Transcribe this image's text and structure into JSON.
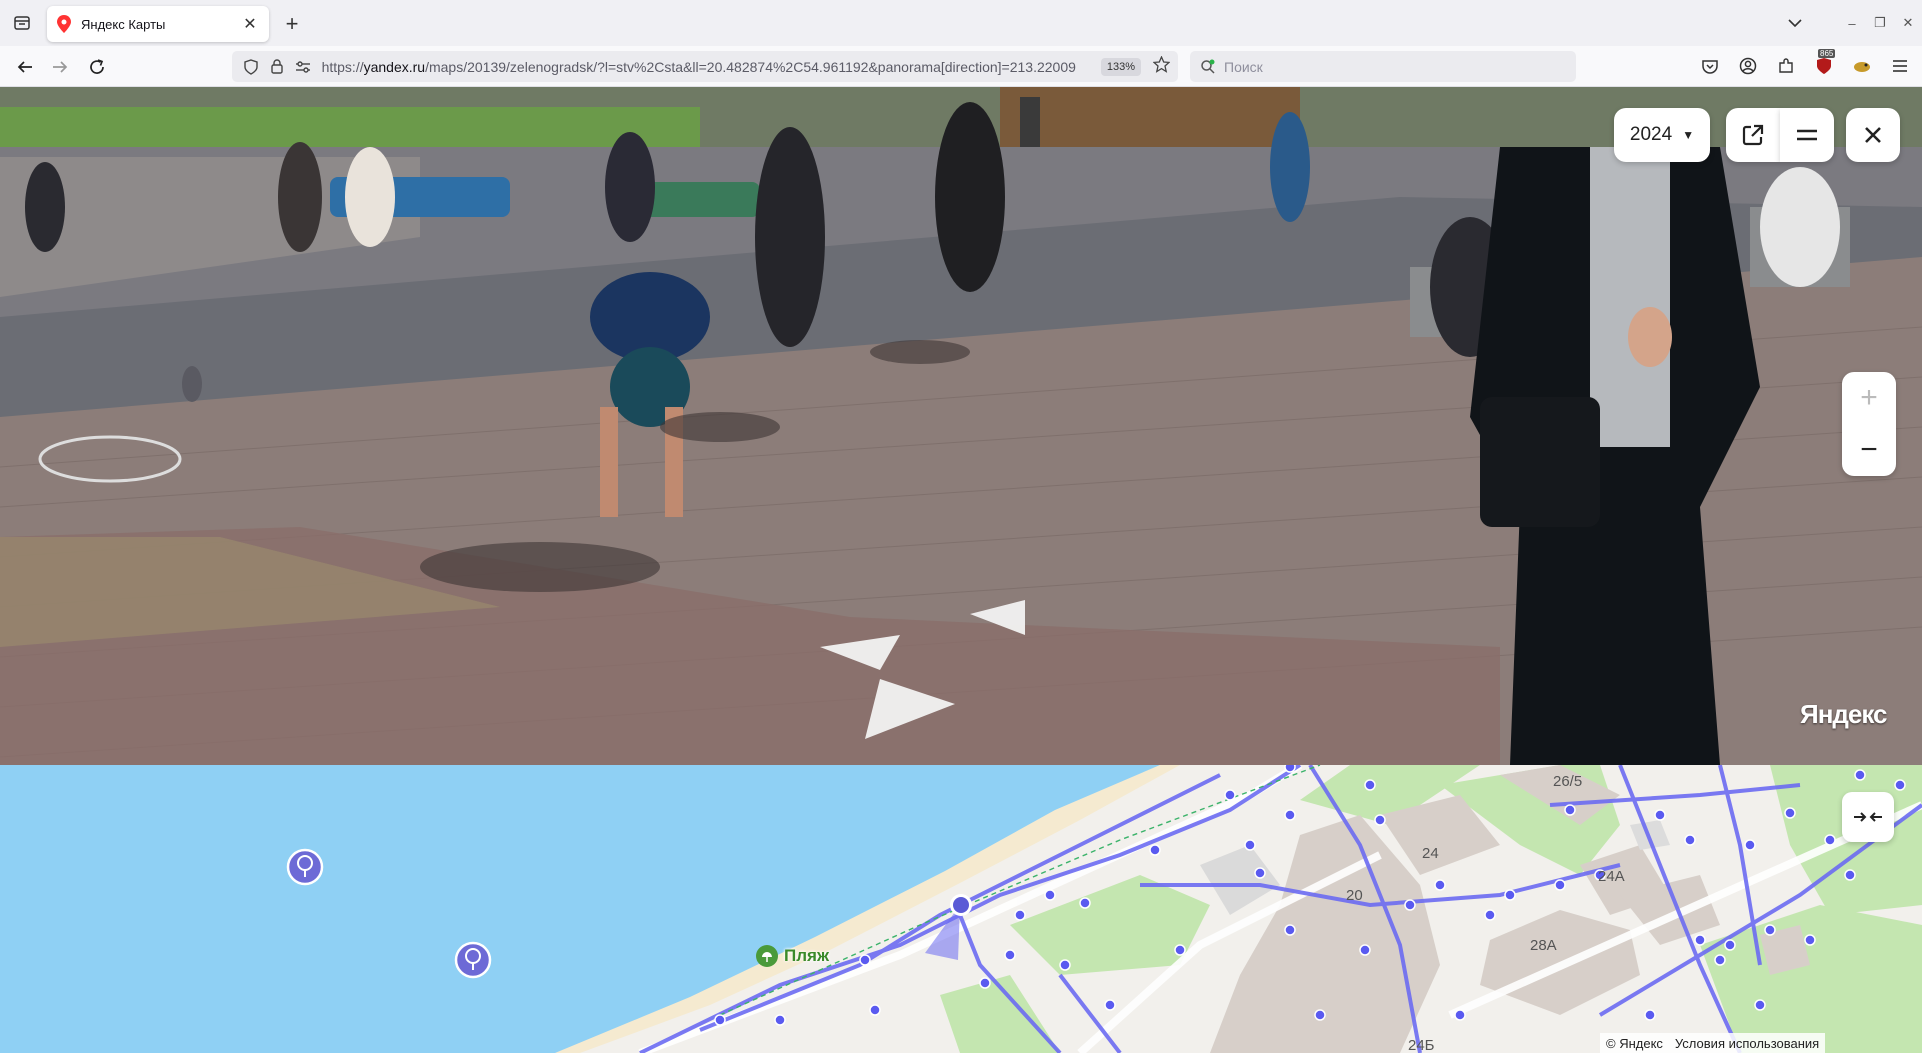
{
  "browser": {
    "tab_title": "Яндекс Карты",
    "url_host": "yandex.ru",
    "url_prefix": "https://",
    "url_path": "/maps/20139/zelenogradsk/?l=stv%2Csta&ll=20.482874%2C54.961192&panorama[direction]=213.22009",
    "zoom_level": "133%",
    "search_placeholder": "Поиск",
    "extension_badge": "865"
  },
  "panorama": {
    "year": "2024",
    "logo": "Яндекс",
    "zoom_in_label": "+",
    "zoom_out_label": "−"
  },
  "map": {
    "labels": {
      "b20": "20",
      "b24": "24",
      "b24a": "24А",
      "b26_5": "26/5",
      "b28a": "28А",
      "b24b": "24Б"
    },
    "beach_label": "Пляж",
    "copyright": "© Яндекс",
    "terms": "Условия использования"
  },
  "colors": {
    "water": "#8fd0f4",
    "route": "#6c6cf2",
    "park": "#c4e6b0",
    "building": "#d7cfc9"
  }
}
